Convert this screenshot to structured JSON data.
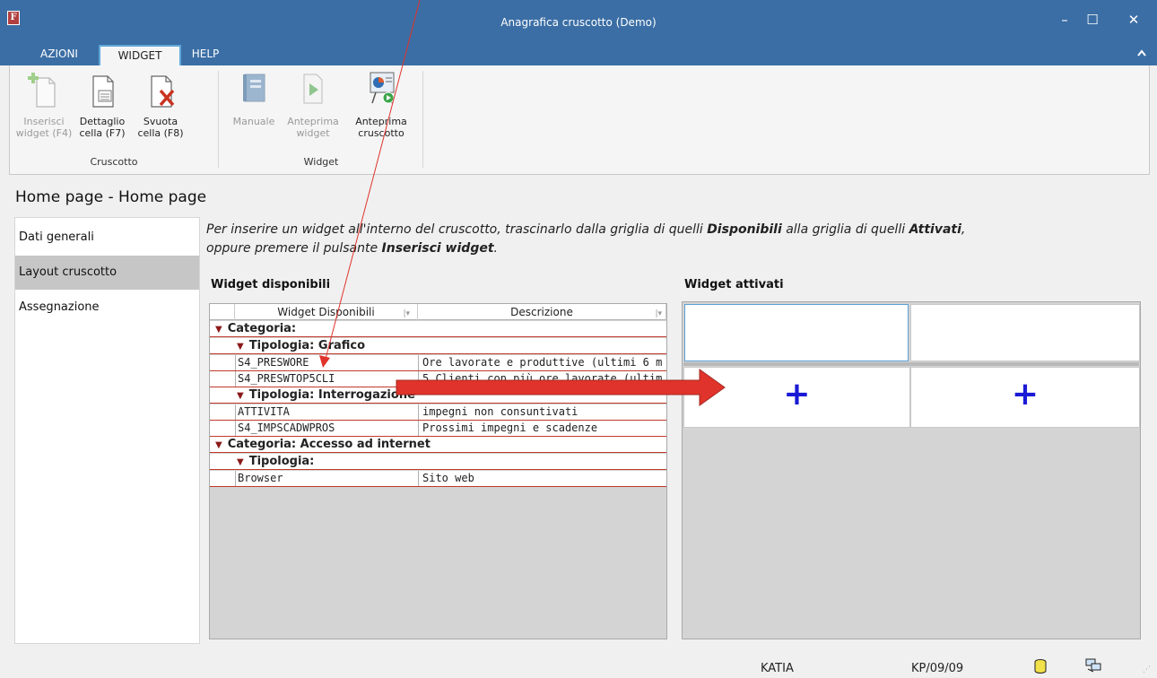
{
  "window": {
    "title": "Anagrafica cruscotto  (Demo)",
    "app_icon_letter": "F",
    "minimize": "–",
    "maximize": "☐",
    "close": "✕"
  },
  "tabs": [
    {
      "label": "AZIONI"
    },
    {
      "label": "WIDGET",
      "active": true
    },
    {
      "label": "HELP"
    }
  ],
  "ribbon": {
    "collapse_icon": "chevron-up",
    "groups": [
      {
        "label": "Cruscotto",
        "buttons": [
          {
            "line1": "Inserisci",
            "line2": "widget (F4)",
            "icon": "insert-widget-icon",
            "enabled": false
          },
          {
            "line1": "Dettaglio",
            "line2": "cella (F7)",
            "icon": "detail-cell-icon",
            "enabled": true
          },
          {
            "line1": "Svuota",
            "line2": "cella (F8)",
            "icon": "clear-cell-icon",
            "enabled": true
          }
        ]
      },
      {
        "label": "Widget",
        "buttons": [
          {
            "line1": "Manuale",
            "line2": "",
            "icon": "manual-icon",
            "enabled": false
          },
          {
            "line1": "Anteprima",
            "line2": "widget",
            "icon": "preview-widget-icon",
            "enabled": false
          },
          {
            "line1": "Anteprima",
            "line2": "cruscotto",
            "icon": "preview-dashboard-icon",
            "enabled": true
          }
        ]
      }
    ]
  },
  "page": {
    "title": "Home page - Home page"
  },
  "nav": {
    "items": [
      {
        "label": "Dati generali"
      },
      {
        "label": "Layout cruscotto",
        "selected": true
      },
      {
        "label": "Assegnazione"
      }
    ]
  },
  "instructions": {
    "p1": "Per inserire un widget all'interno del cruscotto, trascinarlo dalla griglia di quelli ",
    "b1": "Disponibili",
    "p2": " alla griglia di quelli ",
    "b2": "Attivati",
    "p3": ",",
    "p4": "oppure premere il pulsante ",
    "b3": "Inserisci widget",
    "p5": "."
  },
  "available": {
    "title": "Widget disponibili",
    "columns": [
      "Widget Disponibili",
      "Descrizione"
    ],
    "rows": [
      {
        "kind": "cat",
        "label": "Categoria:"
      },
      {
        "kind": "type",
        "label": "Tipologia: Grafico"
      },
      {
        "kind": "data",
        "name": "S4_PRESWORE",
        "desc": "Ore lavorate e produttive (ultimi 6 m"
      },
      {
        "kind": "data",
        "name": "S4_PRESWTOP5CLI",
        "desc": "5 Clienti con più ore lavorate (ultim"
      },
      {
        "kind": "type",
        "label": "Tipologia: Interrogazione"
      },
      {
        "kind": "data",
        "name": "ATTIVITA",
        "desc": "impegni non consuntivati"
      },
      {
        "kind": "data",
        "name": "S4_IMPSCADWPROS",
        "desc": "Prossimi impegni e scadenze"
      },
      {
        "kind": "cat",
        "label": "Categoria: Accesso ad internet"
      },
      {
        "kind": "type",
        "label": "Tipologia:"
      },
      {
        "kind": "data",
        "name": "Browser",
        "desc": "Sito web"
      }
    ]
  },
  "activated": {
    "title": "Widget attivati",
    "plus": "+"
  },
  "status": {
    "user": "KATIA",
    "code": "KP/09/09"
  },
  "colors": {
    "titlebar": "#3b6ea5",
    "plus": "#1a1ad6",
    "annotation_red": "#e0332b"
  }
}
